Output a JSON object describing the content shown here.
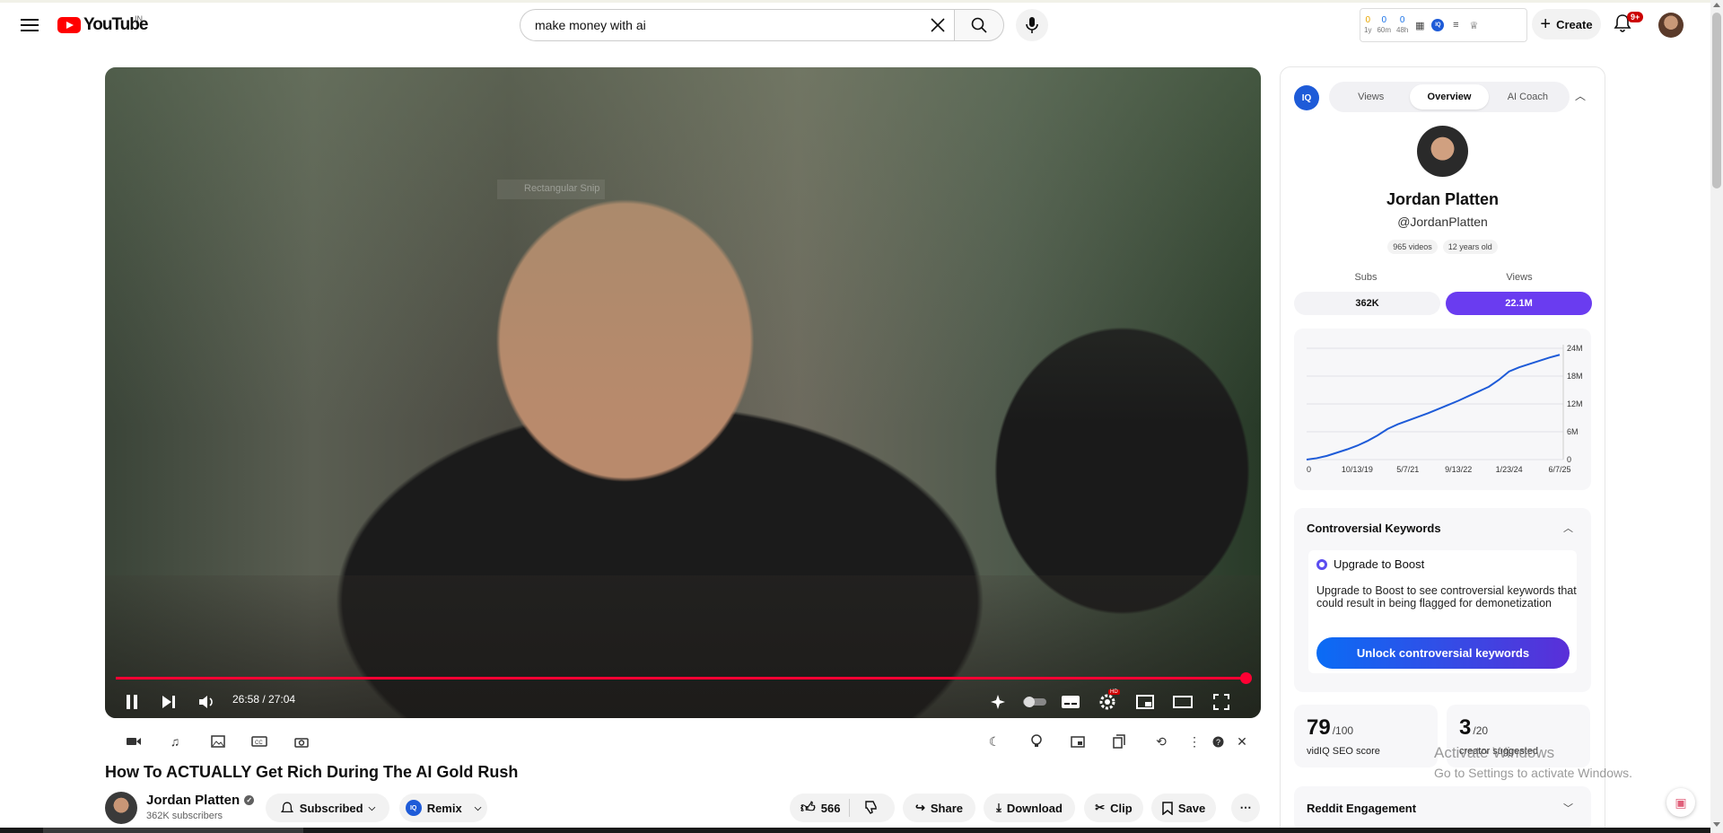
{
  "header": {
    "logo_text": "YouTube",
    "country": "IN",
    "search": {
      "value": "make money with ai"
    },
    "vidiq": {
      "stats": [
        {
          "value": "0",
          "label": "1y"
        },
        {
          "value": "0",
          "label": "60m"
        },
        {
          "value": "0",
          "label": "48h"
        }
      ]
    },
    "create_label": "Create",
    "notifications_badge": "9+"
  },
  "player": {
    "overlay_text": "Rectangular Snip",
    "current_time": "26:58",
    "duration": "27:04",
    "progress": 0.996,
    "hd_badge": "HD"
  },
  "video": {
    "title": "How To ACTUALLY Get Rich During The AI Gold Rush",
    "channel_name": "Jordan Platten",
    "channel_subs": "362K subscribers",
    "subscribed_label": "Subscribed",
    "remix_label": "Remix",
    "like_count": "566",
    "share_label": "Share",
    "download_label": "Download",
    "clip_label": "Clip",
    "save_label": "Save"
  },
  "panel": {
    "logo": "IQ",
    "tabs": [
      "Views",
      "Overview",
      "AI Coach"
    ],
    "active_tab": "Overview",
    "channel_name": "Jordan Platten",
    "handle": "@JordanPlatten",
    "tags": [
      "965 videos",
      "12 years old"
    ],
    "subs_label": "Subs",
    "views_label": "Views",
    "subs_value": "362K",
    "views_value": "22.1M",
    "controversial": {
      "title": "Controversial Keywords",
      "upgrade_title": "Upgrade to Boost",
      "upgrade_text": "Upgrade to Boost to see controversial keywords that could result in being flagged for demonetization",
      "button": "Unlock controversial keywords"
    },
    "seo": {
      "score": "79",
      "max": "/100",
      "label": "vidIQ SEO score"
    },
    "creator": {
      "score": "3",
      "max": "/20",
      "label": "creator suggested"
    },
    "reddit_title": "Reddit Engagement"
  },
  "watermark": {
    "line1": "Activate Windows",
    "line2": "Go to Settings to activate Windows."
  },
  "colors": {
    "youtube_red": "#ff0000",
    "progress_red": "#ff0033",
    "vidiq_purple": "#6a3cf0",
    "vidiq_blue": "#1e5bd8"
  },
  "chart_data": {
    "type": "line",
    "x_ticks": [
      "0",
      "10/13/19",
      "5/7/21",
      "9/13/22",
      "1/23/24",
      "6/7/25"
    ],
    "y_ticks": [
      "0",
      "6M",
      "12M",
      "18M",
      "24M"
    ],
    "ylim": [
      0,
      24
    ],
    "y_unit": "M",
    "xlim": [
      0,
      100
    ],
    "series": [
      {
        "x": [
          0,
          4,
          8,
          12,
          16,
          20,
          24,
          28,
          32,
          36,
          40,
          44,
          48,
          52,
          56,
          60,
          64,
          68,
          72,
          76,
          80,
          84,
          88,
          92,
          96,
          100
        ],
        "values": [
          0,
          0.3,
          0.8,
          1.5,
          2.2,
          3.0,
          4.0,
          5.2,
          6.6,
          7.6,
          8.4,
          9.2,
          10.0,
          10.9,
          11.8,
          12.7,
          13.7,
          14.7,
          15.7,
          17.2,
          19.0,
          19.9,
          20.6,
          21.3,
          22.0,
          22.6
        ]
      }
    ],
    "grid": true
  }
}
